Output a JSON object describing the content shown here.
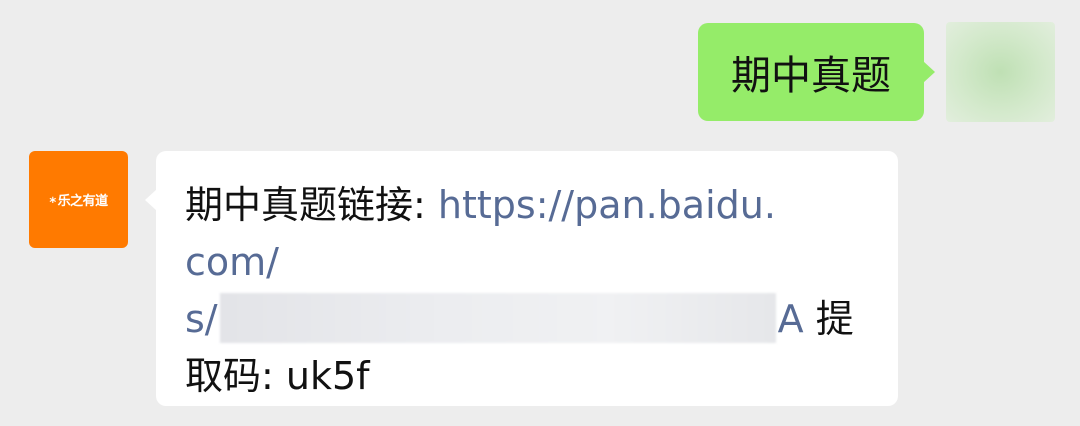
{
  "outgoing": {
    "text": "期中真题"
  },
  "incoming": {
    "avatar_label": "乐之有道",
    "avatar_logo_glyph": "⁎",
    "label": "期中真题链接: ",
    "link_line1": "https://pan.baidu.",
    "link_line2": "com/",
    "link_prefix": "s/",
    "link_suffix": "A",
    "code_label_part1": " 提",
    "code_label_part2": "取码: ",
    "code_value": "uk5f"
  },
  "colors": {
    "background": "#ededed",
    "outgoing_bubble": "#95ec69",
    "incoming_bubble": "#ffffff",
    "link": "#576b95",
    "avatar_orange": "#ff7a00"
  }
}
